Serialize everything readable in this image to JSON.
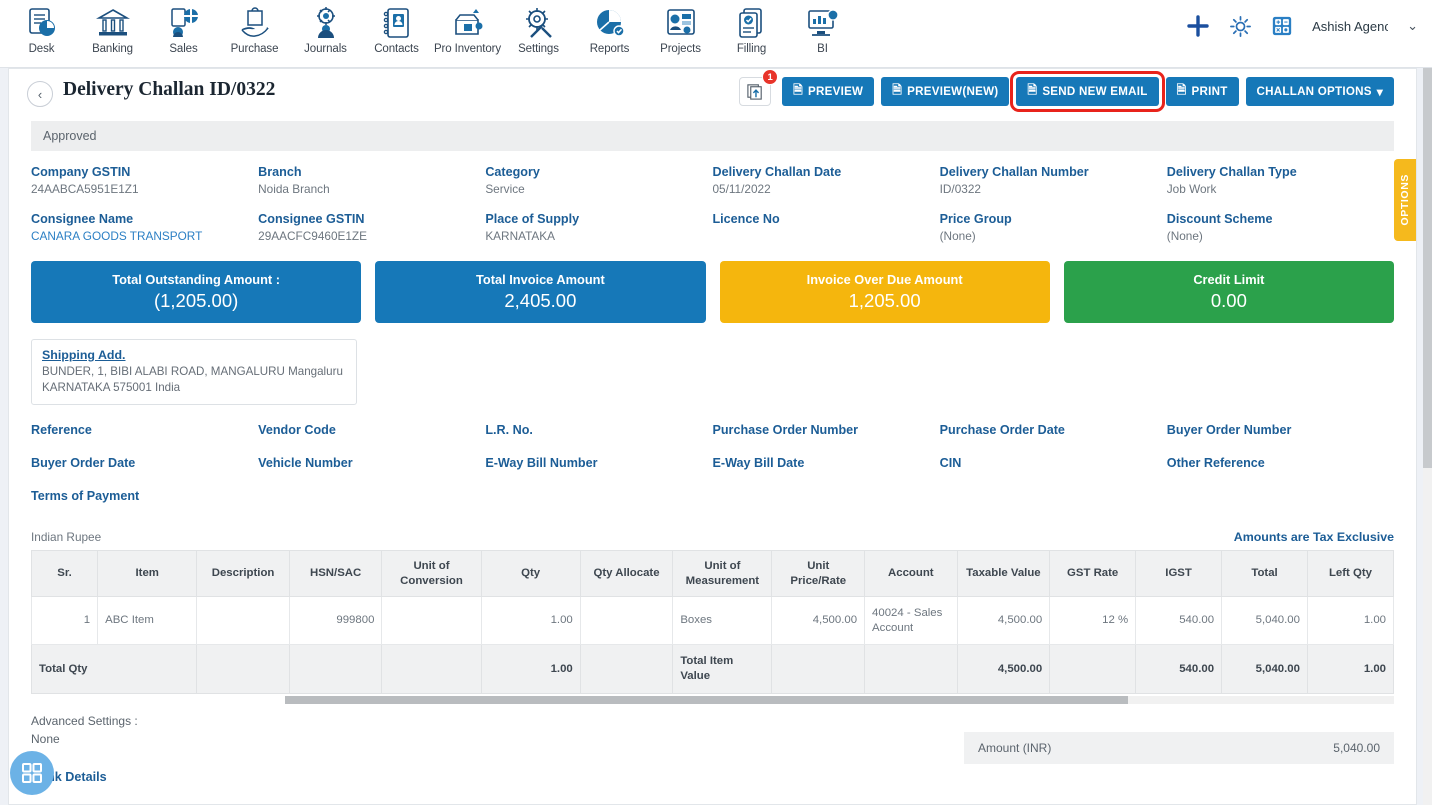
{
  "topnav": {
    "items": [
      {
        "label": "Desk",
        "icon": "desk-icon"
      },
      {
        "label": "Banking",
        "icon": "bank-icon"
      },
      {
        "label": "Sales",
        "icon": "sales-icon"
      },
      {
        "label": "Purchase",
        "icon": "purchase-icon"
      },
      {
        "label": "Journals",
        "icon": "journals-icon"
      },
      {
        "label": "Contacts",
        "icon": "contacts-icon"
      },
      {
        "label": "Pro Inventory",
        "icon": "inventory-icon"
      },
      {
        "label": "Settings",
        "icon": "settings-icon"
      },
      {
        "label": "Reports",
        "icon": "reports-icon"
      },
      {
        "label": "Projects",
        "icon": "projects-icon"
      },
      {
        "label": "Filling",
        "icon": "filling-icon"
      },
      {
        "label": "BI",
        "icon": "bi-icon"
      }
    ],
    "add_icon": "plus-icon",
    "gear_icon": "gear-icon",
    "calculator_icon": "calculator-icon",
    "user_name": "Ashish Agenc",
    "user_caret": "⌄"
  },
  "header": {
    "back_icon": "‹",
    "title": "Delivery Challan ID/0322",
    "upload_icon": "upload-documents-icon",
    "upload_badge": "1",
    "buttons": [
      {
        "label": "PREVIEW",
        "icon": "🗎",
        "highlight": false
      },
      {
        "label": "PREVIEW(NEW)",
        "icon": "🗎",
        "highlight": false
      },
      {
        "label": "SEND NEW EMAIL",
        "icon": "🗎",
        "highlight": true
      },
      {
        "label": "PRINT",
        "icon": "🗎",
        "highlight": false
      },
      {
        "label": "CHALLAN OPTIONS",
        "icon": "",
        "highlight": false,
        "caret": "▾"
      }
    ],
    "options_tab": "OPTIONS"
  },
  "status": {
    "label": "Approved"
  },
  "details": {
    "row1": [
      {
        "label": "Company GSTIN",
        "value": "24AABCA5951E1Z1",
        "link": false
      },
      {
        "label": "Branch",
        "value": "Noida Branch",
        "link": false
      },
      {
        "label": "Category",
        "value": "Service",
        "link": false
      },
      {
        "label": "Delivery Challan Date",
        "value": "05/11/2022",
        "link": false
      },
      {
        "label": "Delivery Challan Number",
        "value": "ID/0322",
        "link": false
      },
      {
        "label": "Delivery Challan Type",
        "value": "Job Work",
        "link": false
      }
    ],
    "row2": [
      {
        "label": "Consignee Name",
        "value": "CANARA GOODS TRANSPORT",
        "link": true
      },
      {
        "label": "Consignee GSTIN",
        "value": "29AACFC9460E1ZE",
        "link": false
      },
      {
        "label": "Place of Supply",
        "value": "KARNATAKA",
        "link": false
      },
      {
        "label": "Licence No",
        "value": "",
        "link": false
      },
      {
        "label": "Price Group",
        "value": "(None)",
        "link": false
      },
      {
        "label": "Discount Scheme",
        "value": "(None)",
        "link": false
      }
    ]
  },
  "cards": [
    {
      "title": "Total Outstanding Amount :",
      "value": "(1,205.00)",
      "color": "#1678b8"
    },
    {
      "title": "Total Invoice Amount",
      "value": "2,405.00",
      "color": "#1678b8"
    },
    {
      "title": "Invoice Over Due Amount",
      "value": "1,205.00",
      "color": "#f5b60d"
    },
    {
      "title": "Credit Limit",
      "value": "0.00",
      "color": "#2ba14b"
    }
  ],
  "shipping": {
    "title": "Shipping Add.",
    "line1": "BUNDER, 1, BIBI ALABI ROAD, MANGALURU Mangaluru",
    "line2": "KARNATAKA 575001 India"
  },
  "empty_labels": {
    "row1": [
      "Reference",
      "Vendor Code",
      "L.R. No.",
      "Purchase Order Number",
      "Purchase Order Date",
      "Buyer Order Number"
    ],
    "row2": [
      "Buyer Order Date",
      "Vehicle Number",
      "E-Way Bill Number",
      "E-Way Bill Date",
      "CIN",
      "Other Reference"
    ],
    "row3": [
      "Terms of Payment"
    ]
  },
  "items_section": {
    "currency": "Indian Rupee",
    "tax_note": "Amounts are Tax Exclusive",
    "columns": [
      "Sr.",
      "Item",
      "Description",
      "HSN/SAC",
      "Unit of Conversion",
      "Qty",
      "Qty Allocate",
      "Unit of Measurement",
      "Unit Price/Rate",
      "Account",
      "Taxable Value",
      "GST Rate",
      "IGST",
      "Total",
      "Left Qty"
    ],
    "rows": [
      {
        "sr": "1",
        "item": "ABC Item",
        "description": "",
        "hsn": "999800",
        "unit_conversion": "",
        "qty": "1.00",
        "qty_allocate": "",
        "uom": "Boxes",
        "unit_price": "4,500.00",
        "account": "40024 - Sales Account",
        "taxable_value": "4,500.00",
        "gst_rate": "12 %",
        "igst": "540.00",
        "total": "5,040.00",
        "left_qty": "1.00"
      }
    ],
    "footer": {
      "total_qty_label": "Total Qty",
      "total_qty": "1.00",
      "total_item_value_label": "Total Item Value",
      "taxable_value": "4,500.00",
      "igst": "540.00",
      "total": "5,040.00",
      "left_qty": "1.00"
    }
  },
  "bottom": {
    "advanced_settings_label": "Advanced Settings :",
    "advanced_settings_value": "None",
    "bank_details_label": "Bank Details",
    "amount_label": "Amount (INR)",
    "amount_value": "5,040.00"
  },
  "fab": {
    "icon": "grid-apps-icon"
  }
}
